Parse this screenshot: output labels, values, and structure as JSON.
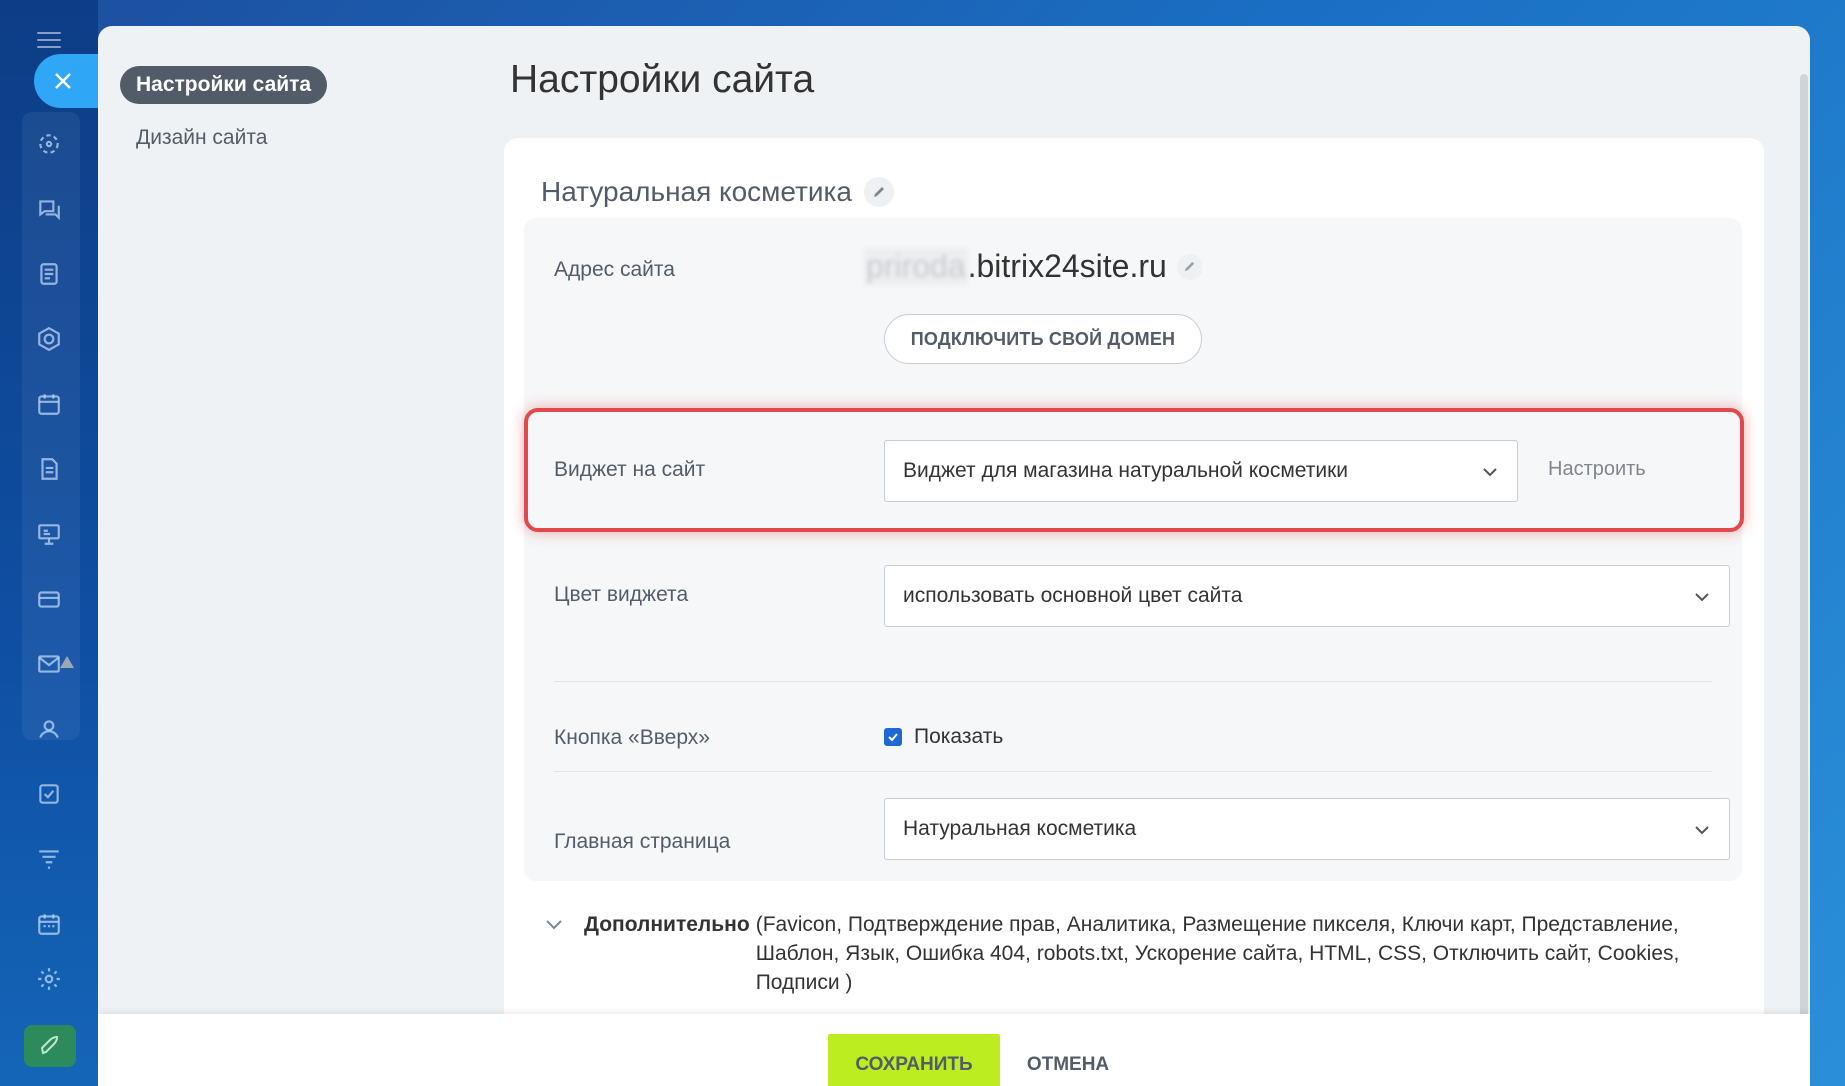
{
  "left_nav": {
    "active": "Настройки сайта",
    "items": [
      "Дизайн сайта"
    ]
  },
  "page": {
    "title": "Настройки сайта"
  },
  "site": {
    "name": "Натуральная косметика",
    "address_label": "Адрес сайта",
    "subdomain": "priroda",
    "domain_suffix": ".bitrix24site.ru",
    "connect_domain_button": "ПОДКЛЮЧИТЬ СВОЙ ДОМЕН"
  },
  "widget": {
    "label": "Виджет на сайт",
    "selected": "Виджет для магазина натуральной косметики",
    "configure_link": "Настроить"
  },
  "widget_color": {
    "label": "Цвет виджета",
    "selected": "использовать основной цвет сайта"
  },
  "scroll_up": {
    "label": "Кнопка «Вверх»",
    "checkbox_label": "Показать",
    "checked": true
  },
  "home_page": {
    "label": "Главная страница",
    "selected": "Натуральная косметика"
  },
  "additional": {
    "title": "Дополнительно",
    "items_line1": "(Favicon,  Подтверждение прав,  Аналитика,  Размещение пикселя,  Ключи карт,  Представление,",
    "items_line2": "Шаблон,  Язык,  Ошибка 404,  robots.txt,  Ускорение сайта,  HTML,  CSS,  Отключить сайт,  Cookies,",
    "items_line3": "Подписи )"
  },
  "footer": {
    "save": "СОХРАНИТЬ",
    "cancel": "ОТМЕНА"
  },
  "colors": {
    "save_button": "#bbed21",
    "highlight_border": "#e2484c",
    "nav_active_bg": "#525c69",
    "checkbox": "#2067d6"
  }
}
